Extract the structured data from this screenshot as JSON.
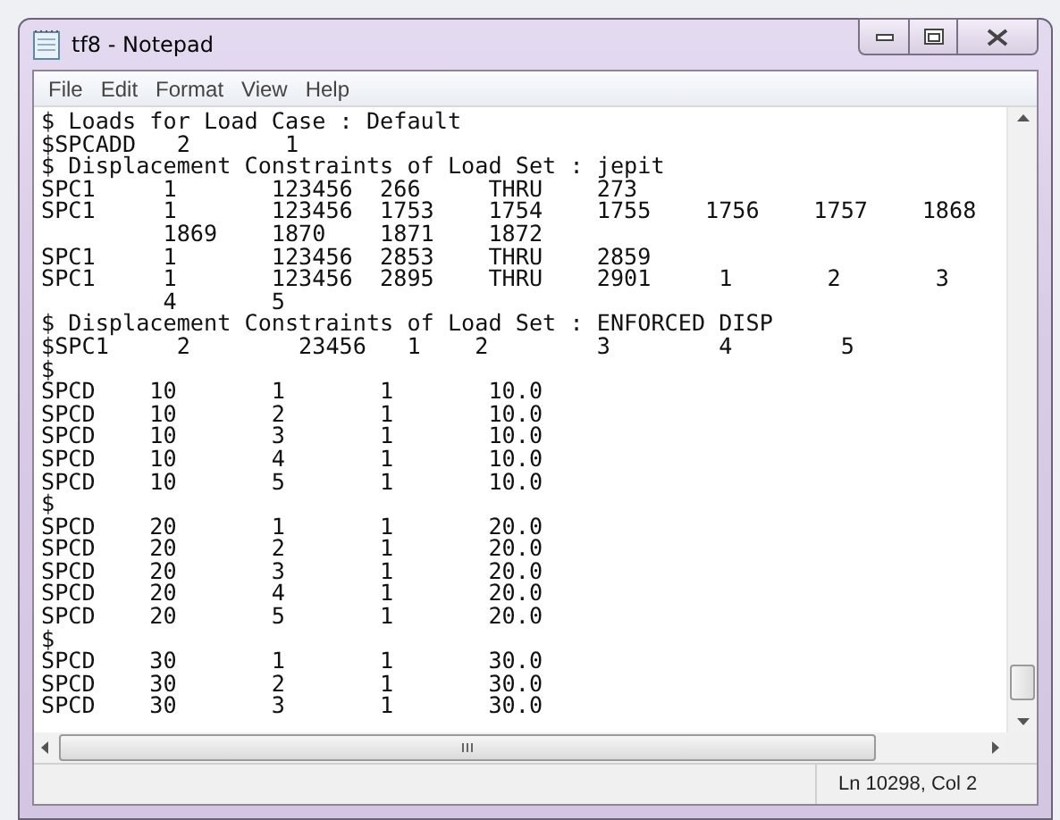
{
  "window": {
    "title": "tf8 - Notepad"
  },
  "menu": [
    "File",
    "Edit",
    "Format",
    "View",
    "Help"
  ],
  "lines": [
    "$ Loads for Load Case : Default",
    "$SPCADD   2       1",
    "$ Displacement Constraints of Load Set : jepit",
    "SPC1     1       123456  266     THRU    273",
    "SPC1     1       123456  1753    1754    1755    1756    1757    1868",
    "         1869    1870    1871    1872",
    "SPC1     1       123456  2853    THRU    2859",
    "SPC1     1       123456  2895    THRU    2901     1       2       3",
    "         4       5",
    "$ Displacement Constraints of Load Set : ENFORCED DISP",
    "$SPC1     2        23456   1    2        3        4        5",
    "$",
    "SPCD    10       1       1       10.0",
    "SPCD    10       2       1       10.0",
    "SPCD    10       3       1       10.0",
    "SPCD    10       4       1       10.0",
    "SPCD    10       5       1       10.0",
    "$",
    "SPCD    20       1       1       20.0",
    "SPCD    20       2       1       20.0",
    "SPCD    20       3       1       20.0",
    "SPCD    20       4       1       20.0",
    "SPCD    20       5       1       20.0",
    "$",
    "SPCD    30       1       1       30.0",
    "SPCD    30       2       1       30.0",
    "SPCD    30       3       1       30.0"
  ],
  "status_bar": {
    "position": "Ln 10298, Col 2"
  }
}
